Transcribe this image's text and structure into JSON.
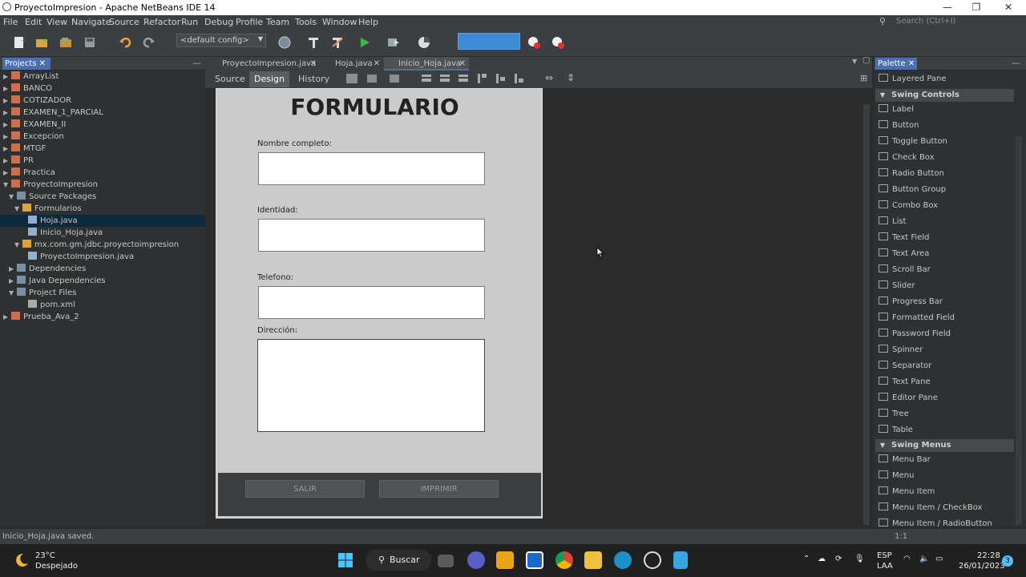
{
  "window": {
    "title": "ProyectoImpresion - Apache NetBeans IDE 14"
  },
  "menubar": [
    "File",
    "Edit",
    "View",
    "Navigate",
    "Source",
    "Refactor",
    "Run",
    "Debug",
    "Profile",
    "Team",
    "Tools",
    "Window",
    "Help"
  ],
  "search": {
    "placeholder": "Search (Ctrl+I)"
  },
  "toolbar": {
    "config": "<default config>"
  },
  "projects": {
    "tab": "Projects",
    "tree": [
      {
        "label": "ArrayList",
        "level": 0,
        "arrow": "▶",
        "icon": "project"
      },
      {
        "label": "BANCO",
        "level": 0,
        "arrow": "▶",
        "icon": "project"
      },
      {
        "label": "COTIZADOR",
        "level": 0,
        "arrow": "▶",
        "icon": "project"
      },
      {
        "label": "EXAMEN_1_PARCIAL",
        "level": 0,
        "arrow": "▶",
        "icon": "project"
      },
      {
        "label": "EXAMEN_II",
        "level": 0,
        "arrow": "▶",
        "icon": "project"
      },
      {
        "label": "Excepcion",
        "level": 0,
        "arrow": "▶",
        "icon": "project"
      },
      {
        "label": "MTGF",
        "level": 0,
        "arrow": "▶",
        "icon": "project"
      },
      {
        "label": "PR",
        "level": 0,
        "arrow": "▶",
        "icon": "project"
      },
      {
        "label": "Practica",
        "level": 0,
        "arrow": "▶",
        "icon": "project"
      },
      {
        "label": "ProyectoImpresion",
        "level": 0,
        "arrow": "▼",
        "icon": "project"
      },
      {
        "label": "Source Packages",
        "level": 1,
        "arrow": "▼",
        "icon": "folder"
      },
      {
        "label": "Formularios",
        "level": 2,
        "arrow": "▼",
        "icon": "package"
      },
      {
        "label": "Hoja.java",
        "level": 3,
        "arrow": "",
        "icon": "file",
        "selected": true
      },
      {
        "label": "Inicio_Hoja.java",
        "level": 3,
        "arrow": "",
        "icon": "file"
      },
      {
        "label": "mx.com.gm.jdbc.proyectoimpresion",
        "level": 2,
        "arrow": "▼",
        "icon": "package"
      },
      {
        "label": "ProyectoImpresion.java",
        "level": 3,
        "arrow": "",
        "icon": "file"
      },
      {
        "label": "Dependencies",
        "level": 1,
        "arrow": "▶",
        "icon": "folder"
      },
      {
        "label": "Java Dependencies",
        "level": 1,
        "arrow": "▶",
        "icon": "folder"
      },
      {
        "label": "Project Files",
        "level": 1,
        "arrow": "▼",
        "icon": "folder"
      },
      {
        "label": "pom.xml",
        "level": 3,
        "arrow": "",
        "icon": "xml"
      },
      {
        "label": "Prueba_Ava_2",
        "level": 0,
        "arrow": "▶",
        "icon": "project"
      }
    ]
  },
  "editor": {
    "tabs": [
      "ProyectoImpresion.java",
      "Hoja.java",
      "Inicio_Hoja.java"
    ],
    "active_tab": 2,
    "views": {
      "source": "Source",
      "design": "Design",
      "history": "History"
    },
    "form": {
      "title": "FORMULARIO",
      "labels": {
        "nombre": "Nombre completo:",
        "identidad": "Identidad:",
        "telefono": "Telefono:",
        "direccion": "Dirección:"
      },
      "buttons": {
        "salir": "SALIR",
        "imprimir": "IMPRIMIR"
      }
    }
  },
  "palette": {
    "tab": "Palette",
    "items_top": [
      "Layered Pane"
    ],
    "cat1": "Swing Controls",
    "controls": [
      "Label",
      "Button",
      "Toggle Button",
      "Check Box",
      "Radio Button",
      "Button Group",
      "Combo Box",
      "List",
      "Text Field",
      "Text Area",
      "Scroll Bar",
      "Slider",
      "Progress Bar",
      "Formatted Field",
      "Password Field",
      "Spinner",
      "Separator",
      "Text Pane",
      "Editor Pane",
      "Tree",
      "Table"
    ],
    "cat2": "Swing Menus",
    "menus": [
      "Menu Bar",
      "Menu",
      "Menu Item",
      "Menu Item / CheckBox",
      "Menu Item / RadioButton"
    ]
  },
  "status": {
    "text": "Inicio_Hoja.java saved.",
    "position": "1:1"
  },
  "taskbar": {
    "weather_temp": "23°C",
    "weather_desc": "Despejado",
    "search": "Buscar",
    "lang1": "ESP",
    "lang2": "LAA",
    "time": "22:28",
    "date": "26/01/2023",
    "notif": "3"
  }
}
